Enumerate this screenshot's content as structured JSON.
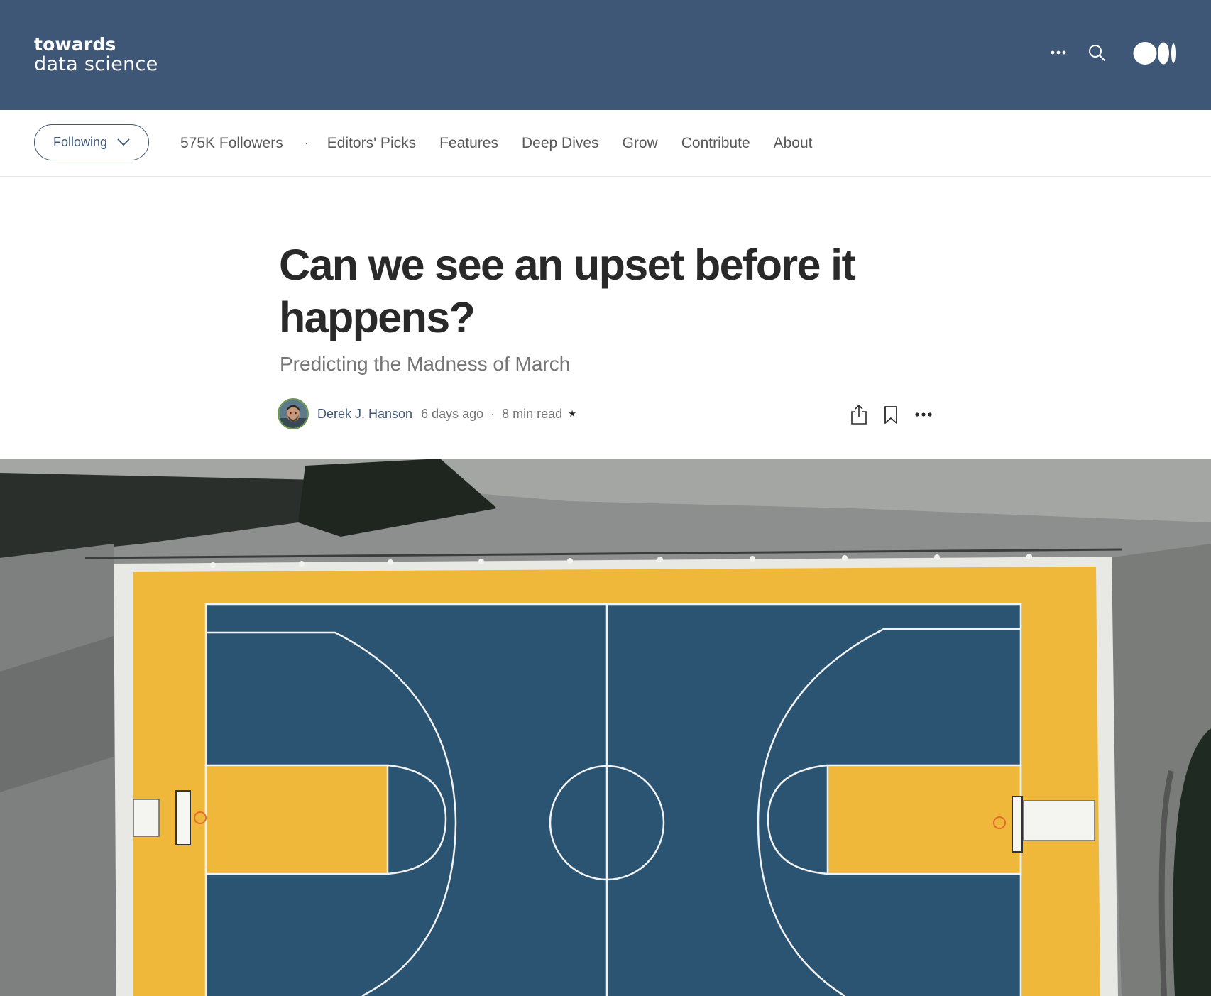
{
  "header": {
    "logo_line1": "towards",
    "logo_line2": "data science",
    "icons": [
      "more-horizontal-icon",
      "search-icon",
      "medium-logo-icon"
    ],
    "background_color": "#3f5777"
  },
  "subnav": {
    "follow_button_label": "Following",
    "followers": "575K Followers",
    "separator": "·",
    "links": [
      "Editors' Picks",
      "Features",
      "Deep Dives",
      "Grow",
      "Contribute",
      "About"
    ]
  },
  "article": {
    "title": "Can we see an upset before it happens?",
    "subtitle": "Predicting the Madness of March",
    "author": "Derek J. Hanson",
    "posted": "6 days ago",
    "read_time": "8 min read",
    "sep": "·",
    "star": "★"
  },
  "hero_image": {
    "description_icon": "basketball-court-aerial-photo",
    "colors": {
      "court_blue": "#2a5372",
      "court_yellow": "#f0b83b",
      "surround": "#8a8c8c"
    }
  }
}
